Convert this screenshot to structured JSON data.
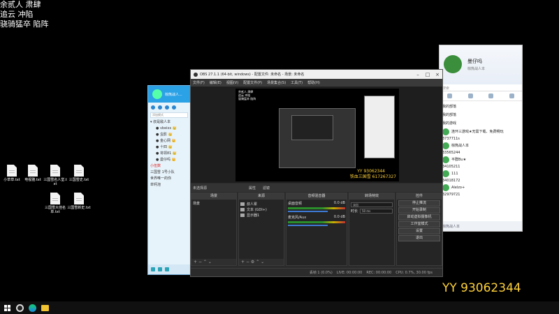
{
  "overlay": {
    "line1": "余贰人 肃肆",
    "line2": "追云 冲陷",
    "line3": "骁骑猛卒 陷阵"
  },
  "desktop_icons": [
    {
      "label": "小草草.txt"
    },
    {
      "label": "电视雅.txt"
    },
    {
      "label": "三国雪名人堂.txt"
    },
    {
      "label": "三国雪史.txt"
    },
    {
      "label": "三国雪大佳名单.txt"
    },
    {
      "label": "三国雪新史.txt"
    }
  ],
  "qq_panel": {
    "header": "棕熊战人...",
    "search": "添加模式",
    "items": [
      {
        "label": "▾ 叔是敌人本"
      },
      {
        "label": "● vbeixs 👑"
      },
      {
        "label": "● 虫影 👑"
      },
      {
        "label": "● 金心网 👑"
      },
      {
        "label": "● 十四 👑"
      },
      {
        "label": "● 将领81 👑"
      },
      {
        "label": "● 曼仔吗 👑"
      },
      {
        "label": "小伍数"
      },
      {
        "label": "三国雪 1号小队"
      },
      {
        "label": "世界唯一的你"
      },
      {
        "label": "单钙泡"
      }
    ]
  },
  "qq_profile": {
    "name": "曼仔吗",
    "subtitle": "棕熊战人本",
    "search": "搜索",
    "items": [
      {
        "label": "我的部落"
      },
      {
        "label": "我的部落"
      },
      {
        "label": "我的游戏"
      },
      {
        "label": "连环三游戏★无需下载、免费畅玩"
      },
      {
        "label": "3737711s"
      },
      {
        "label": "棕熊战人本"
      },
      {
        "label": "33565244"
      },
      {
        "label": "平群Bu★"
      },
      {
        "label": "34105211"
      },
      {
        "label": "111"
      },
      {
        "label": "34018172"
      },
      {
        "label": "Alelzo+"
      },
      {
        "label": "32979721"
      }
    ],
    "footer": "棕熊战人本"
  },
  "obs": {
    "title": "OBS 27.1.1 (64-bit, windows) - 配置文件: 未命名 - 场景: 未命名",
    "menus": [
      "文件(F)",
      "编辑(E)",
      "视图(V)",
      "配置文件(P)",
      "场景集合(S)",
      "工具(T)",
      "帮助(H)"
    ],
    "preview_text": [
      "余贰人 肃肆",
      "追云 冲陷",
      "骁骑猛卒 陷阵"
    ],
    "preview_yy": "YY 93062344",
    "preview_tx": "铁血三国雪 617267327",
    "strip_label": "未选择源",
    "strip_props": "属性",
    "strip_filters": "滤镜",
    "docks": {
      "scenes": {
        "title": "场景",
        "item": "场景"
      },
      "sources": {
        "title": "来源",
        "items": [
          "叔人累",
          "文本 (GDI+)",
          "显示器1"
        ]
      },
      "mixer": {
        "title": "音频混音器",
        "tracks": [
          {
            "name": "桌面音频",
            "db": "0.0 dB"
          },
          {
            "name": "麦克风/Aux",
            "db": "0.0 dB"
          }
        ]
      },
      "transitions": {
        "title": "转场特效",
        "type": "淡出",
        "duration_label": "时长",
        "duration": "50 ms"
      },
      "controls": {
        "title": "控件",
        "buttons": [
          "停止推流",
          "开始录制",
          "启动虚拟摄像机",
          "工作室模式",
          "设置",
          "退出"
        ]
      }
    },
    "status": {
      "dropped": "丢帧 1 (0.0%)",
      "live": "LIVE: 00:00:00",
      "rec": "REC: 00:00:00",
      "cpu": "CPU: 0.7%, 30.00 fps"
    }
  },
  "stream_overlay": {
    "yy": "YY 93062344",
    "tx": "铁血三国雪 617267327"
  },
  "colors": {
    "overlay_yellow": "#ffd23a",
    "qq_blue": "#2ba1e6",
    "obs_bg": "#2b2b2b"
  }
}
